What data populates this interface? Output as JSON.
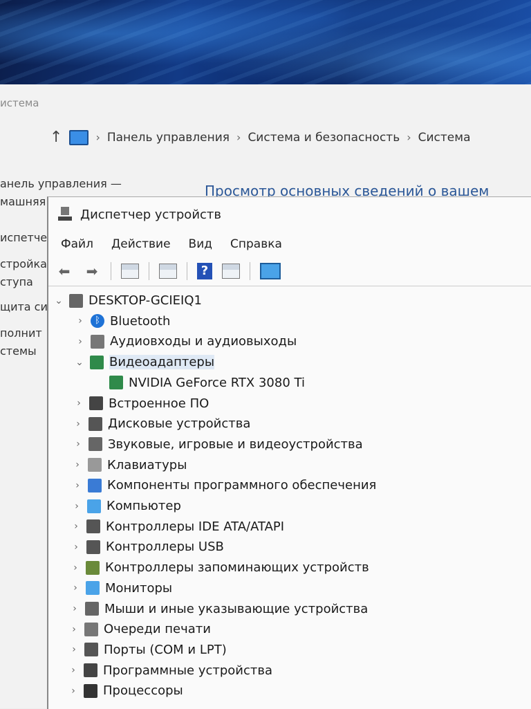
{
  "background_window": {
    "title_fragment": "истема",
    "breadcrumb": [
      "Панель управления",
      "Система и безопасность",
      "Система"
    ],
    "sidebar_fragments": [
      "анель управления —",
      "машняя",
      "испетчер",
      "стройка",
      "ступа",
      "щита си",
      "полнит",
      "стемы"
    ],
    "heading_fragment": "Просмотр основных сведений о вашем"
  },
  "device_manager": {
    "title": "Диспетчер устройств",
    "menu": [
      "Файл",
      "Действие",
      "Вид",
      "Справка"
    ],
    "toolbar_icons": [
      "back-icon",
      "forward-icon",
      "properties-icon",
      "grid-icon",
      "help-icon",
      "update-driver-icon",
      "scan-hardware-icon"
    ],
    "root": "DESKTOP-GCIEIQ1",
    "categories": [
      {
        "label": "Bluetooth",
        "icon": "bluetooth-icon",
        "expanded": false
      },
      {
        "label": "Аудиовходы и аудиовыходы",
        "icon": "speaker-icon",
        "expanded": false
      },
      {
        "label": "Видеоадаптеры",
        "icon": "display-adapter-icon",
        "expanded": true,
        "children": [
          "NVIDIA GeForce RTX 3080 Ti"
        ]
      },
      {
        "label": "Встроенное ПО",
        "icon": "firmware-icon",
        "expanded": false
      },
      {
        "label": "Дисковые устройства",
        "icon": "disk-icon",
        "expanded": false
      },
      {
        "label": "Звуковые, игровые и видеоустройства",
        "icon": "sound-icon",
        "expanded": false
      },
      {
        "label": "Клавиатуры",
        "icon": "keyboard-icon",
        "expanded": false
      },
      {
        "label": "Компоненты программного обеспечения",
        "icon": "software-component-icon",
        "expanded": false
      },
      {
        "label": "Компьютер",
        "icon": "computer-icon",
        "expanded": false
      },
      {
        "label": "Контроллеры IDE ATA/ATAPI",
        "icon": "ide-controller-icon",
        "expanded": false
      },
      {
        "label": "Контроллеры USB",
        "icon": "usb-icon",
        "expanded": false
      },
      {
        "label": "Контроллеры запоминающих устройств",
        "icon": "storage-controller-icon",
        "expanded": false
      },
      {
        "label": "Мониторы",
        "icon": "monitor-icon",
        "expanded": false
      },
      {
        "label": "Мыши и иные указывающие устройства",
        "icon": "mouse-icon",
        "expanded": false
      },
      {
        "label": "Очереди печати",
        "icon": "printer-icon",
        "expanded": false
      },
      {
        "label": "Порты (COM и LPT)",
        "icon": "port-icon",
        "expanded": false
      },
      {
        "label": "Программные устройства",
        "icon": "software-device-icon",
        "expanded": false
      },
      {
        "label": "Процессоры",
        "icon": "processor-icon",
        "expanded": false
      }
    ]
  },
  "colors": {
    "accent": "#2b5797",
    "selection": "#dfe9f5"
  }
}
